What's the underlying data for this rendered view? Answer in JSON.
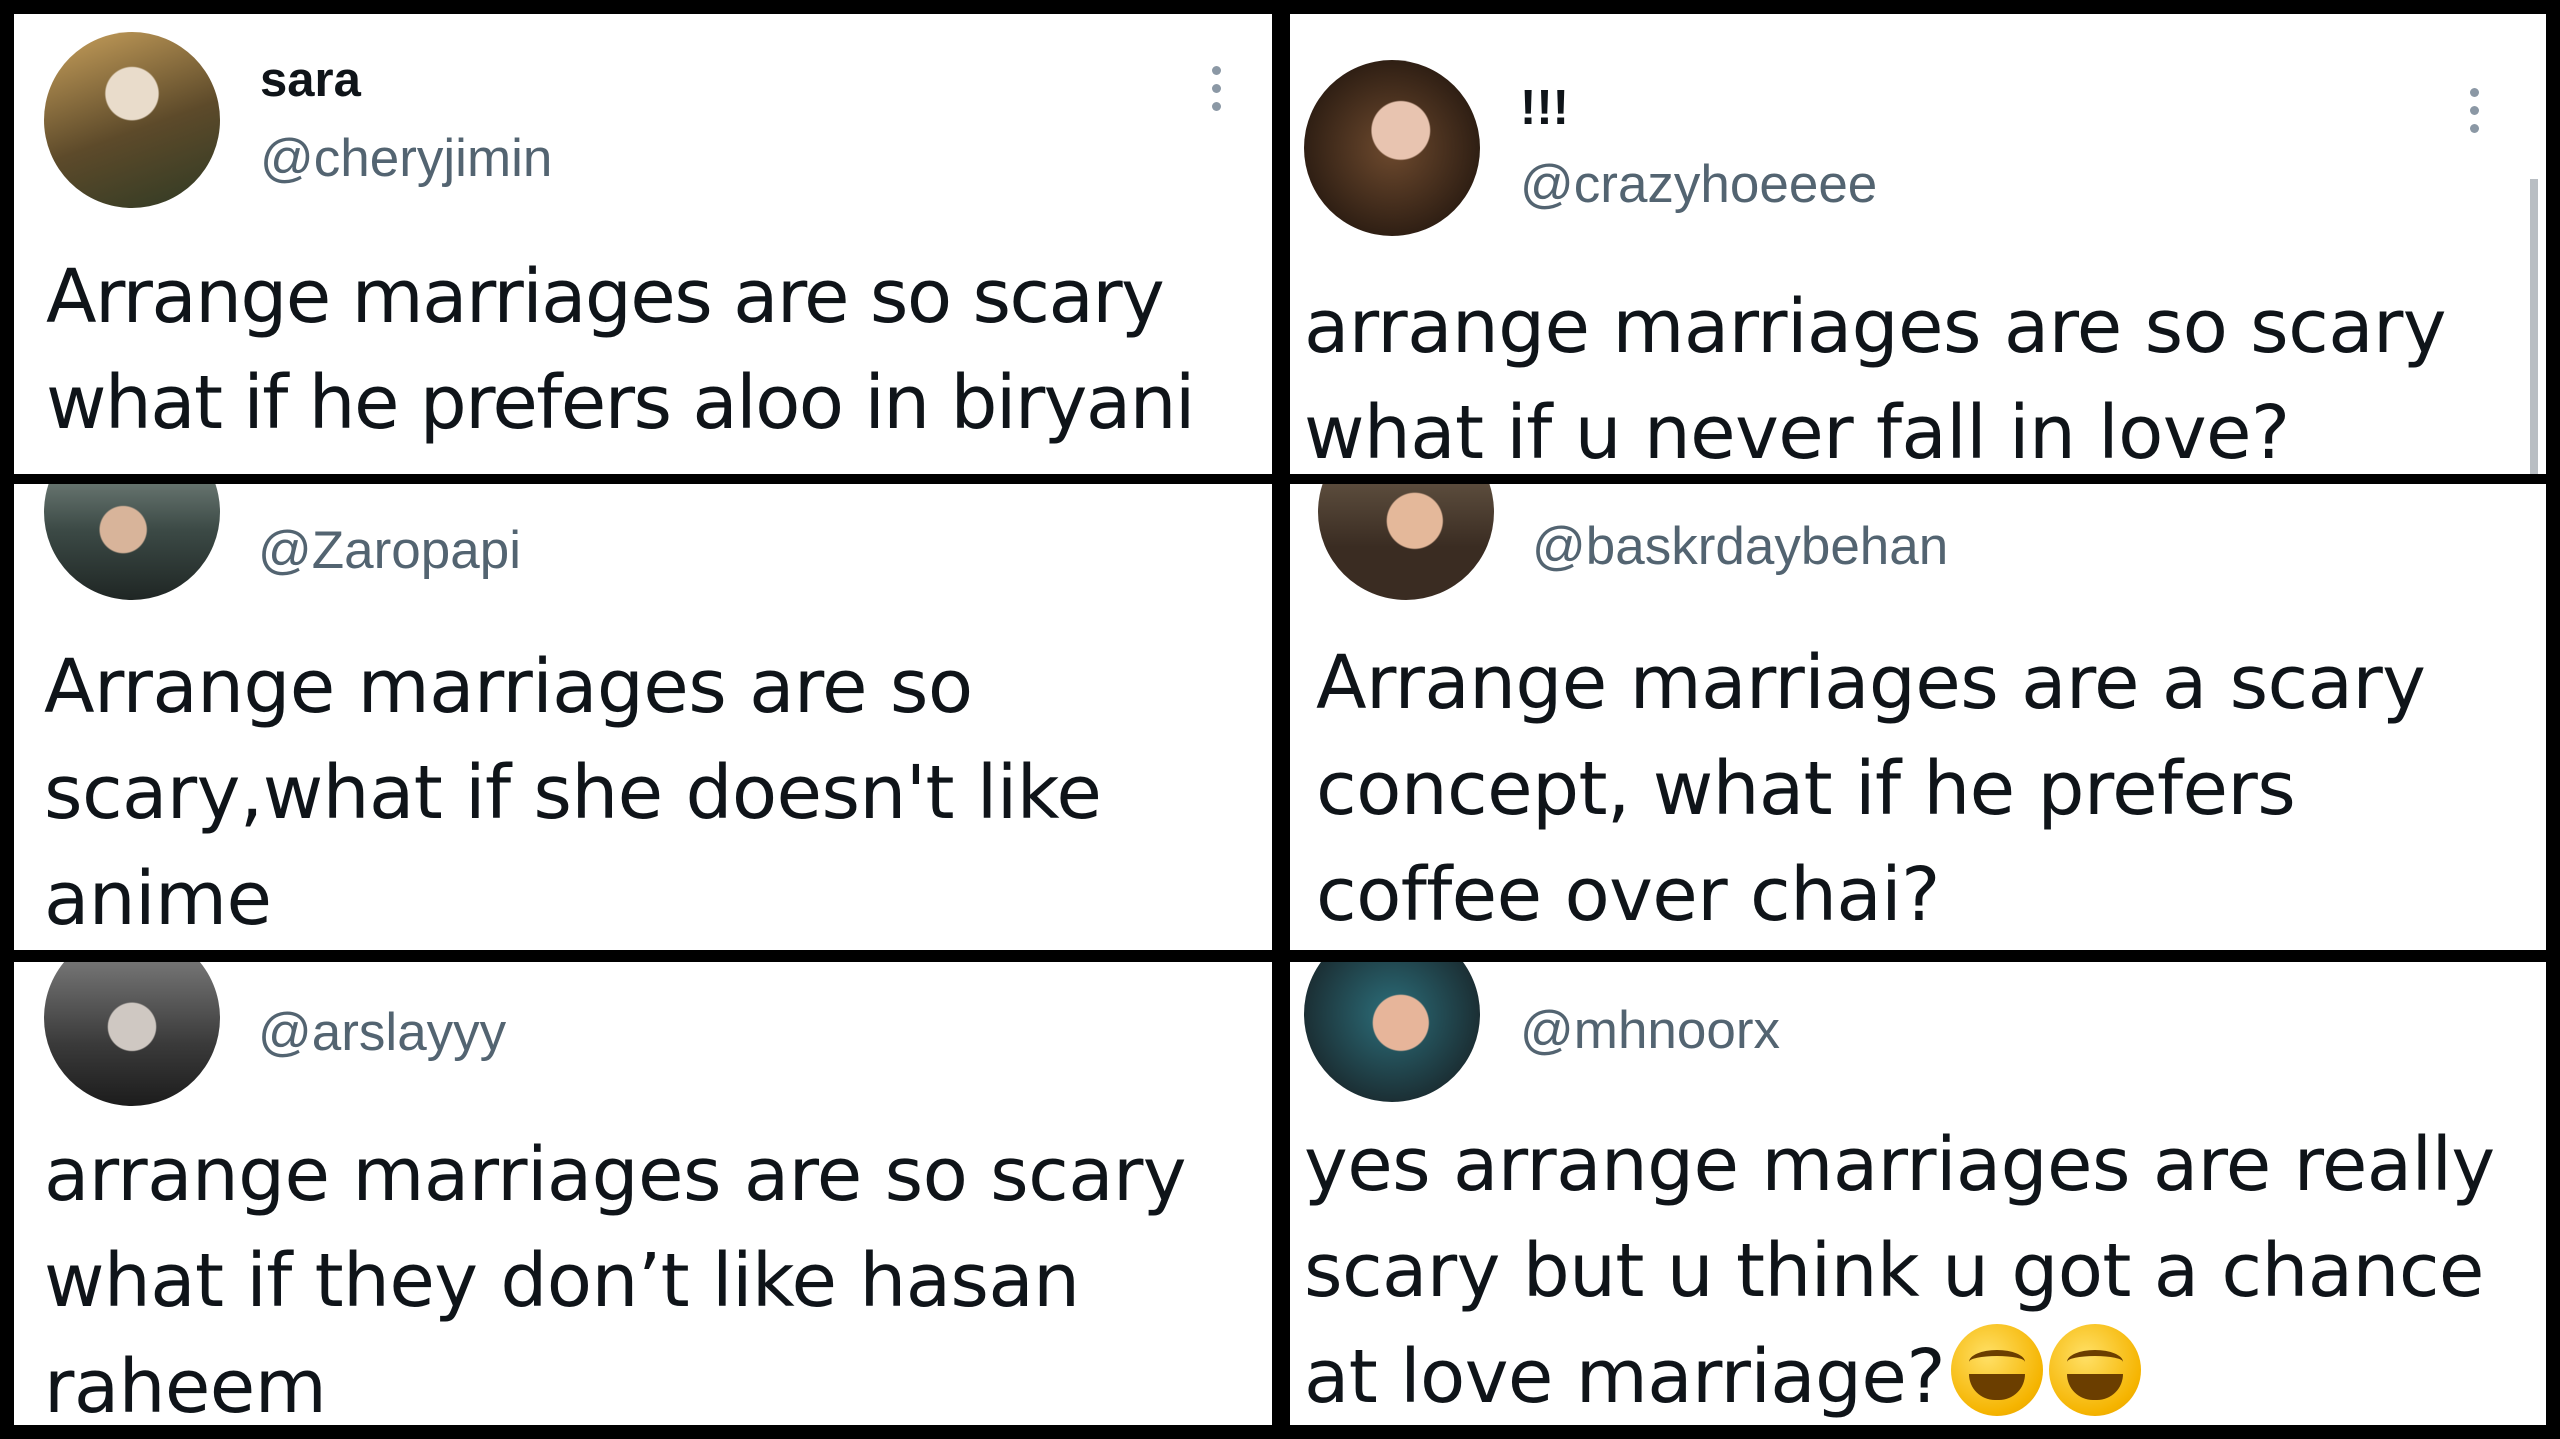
{
  "tweets": [
    {
      "name": "sara",
      "handle": "@cheryjimin",
      "text_lines": [
        "Arrange marriages are so scary",
        "what if he prefers aloo in biryani"
      ]
    },
    {
      "name": "!!!",
      "handle": "@crazyhoeeee",
      "text_lines": [
        "arrange marriages are so scary",
        "what if u never fall in love?"
      ]
    },
    {
      "handle": "@Zaropapi",
      "text_lines": [
        "Arrange marriages are so",
        "scary,what if she doesn't like",
        "anime"
      ]
    },
    {
      "handle": "@baskrdaybehan",
      "text_lines": [
        "Arrange marriages are a scary",
        "concept, what if he prefers",
        "coffee over chai?"
      ]
    },
    {
      "handle": "@arslayyy",
      "text_lines": [
        "arrange marriages are so scary",
        "what if they don’t like hasan",
        "raheem"
      ]
    },
    {
      "handle": "@mhnoorx",
      "text_lines": [
        "yes arrange marriages are really",
        "scary but u think u got a chance",
        "at love marriage?"
      ],
      "trailing_emoji": [
        "grinning-squinting-face-icon",
        "grinning-squinting-face-icon"
      ]
    }
  ]
}
